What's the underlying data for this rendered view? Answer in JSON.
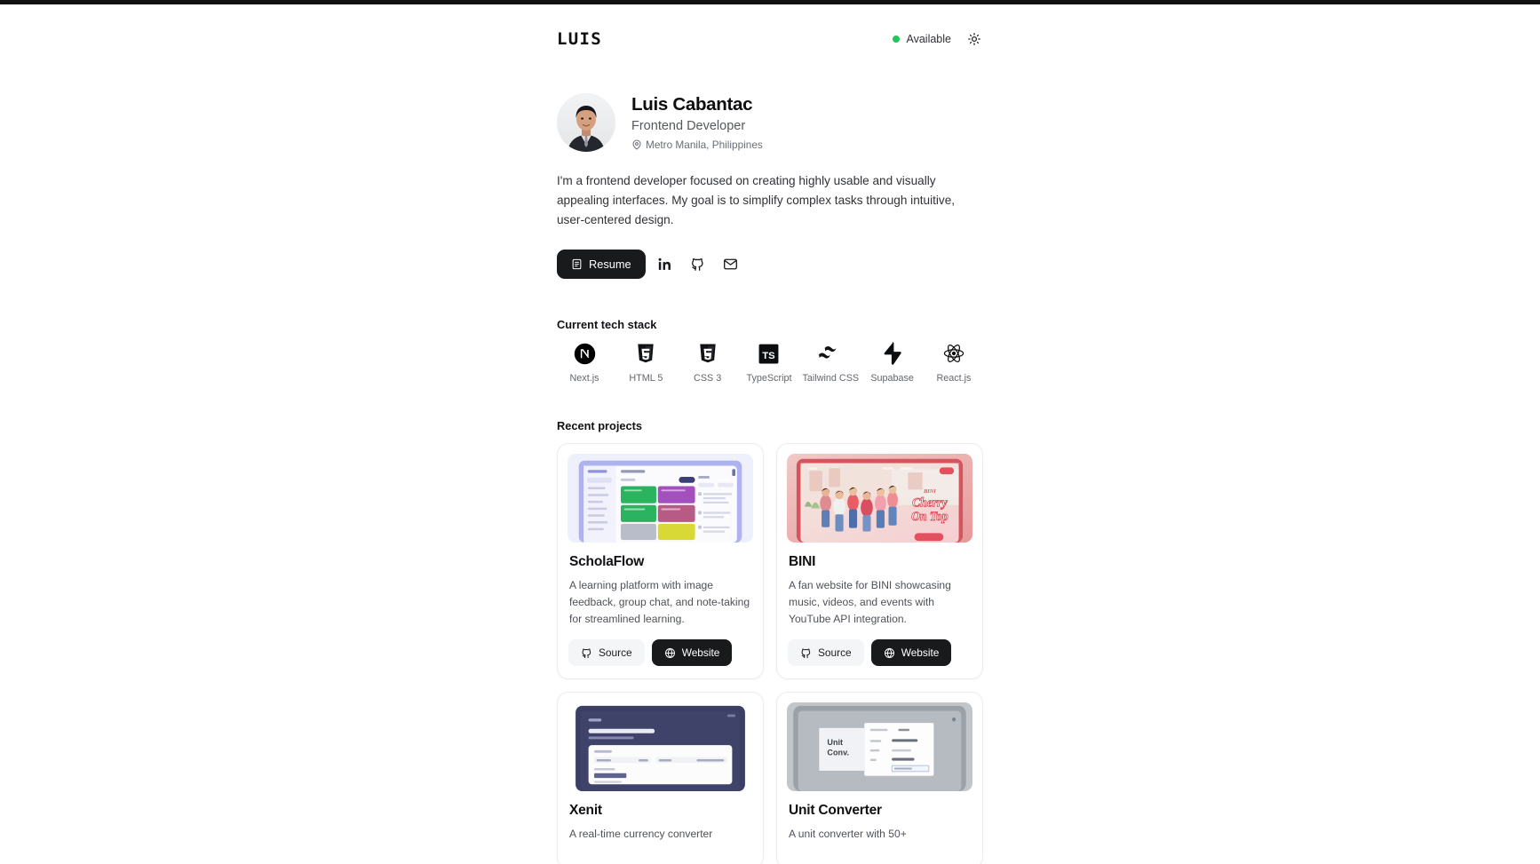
{
  "header": {
    "brand": "LUIS",
    "availability_label": "Available",
    "availability_color": "#22c55e",
    "theme_toggle_icon": "sun-icon"
  },
  "profile": {
    "avatar_icon": "profile-photo",
    "name": "Luis Cabantac",
    "role": "Frontend Developer",
    "location": "Metro Manila, Philippines",
    "location_icon": "map-pin-icon",
    "bio": "I'm a frontend developer focused on creating highly usable and visually appealing interfaces. My goal is to simplify complex tasks through intuitive, user-centered design."
  },
  "actions": {
    "resume_label": "Resume",
    "resume_icon": "file-text-icon",
    "linkedin_icon": "linkedin-icon",
    "github_icon": "github-icon",
    "mail_icon": "mail-icon"
  },
  "tech": {
    "title": "Current tech stack",
    "items": [
      {
        "label": "Next.js",
        "icon": "nextjs-icon"
      },
      {
        "label": "HTML 5",
        "icon": "html5-icon"
      },
      {
        "label": "CSS 3",
        "icon": "css3-icon"
      },
      {
        "label": "TypeScript",
        "icon": "typescript-icon"
      },
      {
        "label": "Tailwind CSS",
        "icon": "tailwind-icon"
      },
      {
        "label": "Supabase",
        "icon": "supabase-icon"
      },
      {
        "label": "React.js",
        "icon": "react-icon"
      }
    ]
  },
  "projects": {
    "title": "Recent projects",
    "source_label": "Source",
    "website_label": "Website",
    "source_icon": "github-icon",
    "website_icon": "globe-icon",
    "items": [
      {
        "name": "ScholaFlow",
        "description": "A learning platform with image feedback, group chat, and note-taking for streamlined learning.",
        "thumbnail": "scholaflow-dashboard-screenshot"
      },
      {
        "name": "BINI",
        "description": "A fan website for BINI showcasing music, videos, and events with YouTube API integration.",
        "thumbnail": "bini-cherry-on-top-screenshot"
      },
      {
        "name": "Xenit",
        "description": "A real-time currency converter",
        "thumbnail": "xenit-converter-screenshot"
      },
      {
        "name": "Unit Converter",
        "description": "A unit converter with 50+",
        "thumbnail": "unit-converter-screenshot"
      }
    ]
  }
}
